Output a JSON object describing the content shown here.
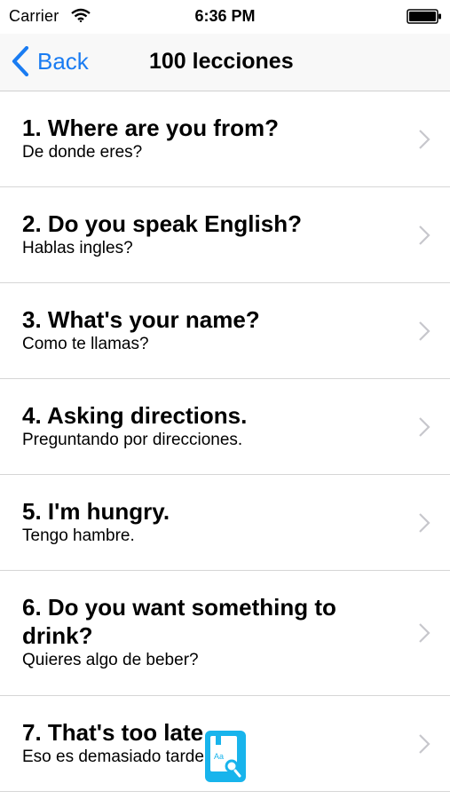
{
  "status_bar": {
    "carrier": "Carrier",
    "time": "6:36 PM",
    "icons": [
      "wifi-icon",
      "battery-icon"
    ]
  },
  "nav": {
    "back_label": "Back",
    "title": "100 lecciones"
  },
  "lessons": [
    {
      "title": "1. Where are you from?",
      "subtitle": "De donde eres?"
    },
    {
      "title": "2. Do you speak English?",
      "subtitle": "Hablas ingles?"
    },
    {
      "title": "3. What's your name?",
      "subtitle": "Como te llamas?"
    },
    {
      "title": "4. Asking directions.",
      "subtitle": "Preguntando por direcciones."
    },
    {
      "title": "5. I'm hungry.",
      "subtitle": "Tengo hambre."
    },
    {
      "title": "6. Do you want something to drink?",
      "subtitle": "Quieres algo de beber?"
    },
    {
      "title": "7. That's too late",
      "subtitle": "Eso es demasiado tarde"
    }
  ],
  "floating_button": {
    "icon": "dictionary-search-icon",
    "label": "Aa"
  },
  "colors": {
    "accent": "#1a7cf2",
    "floating_button": "#18b4ec",
    "separator": "#d6d6d6",
    "chevron": "#c7c7cc"
  }
}
